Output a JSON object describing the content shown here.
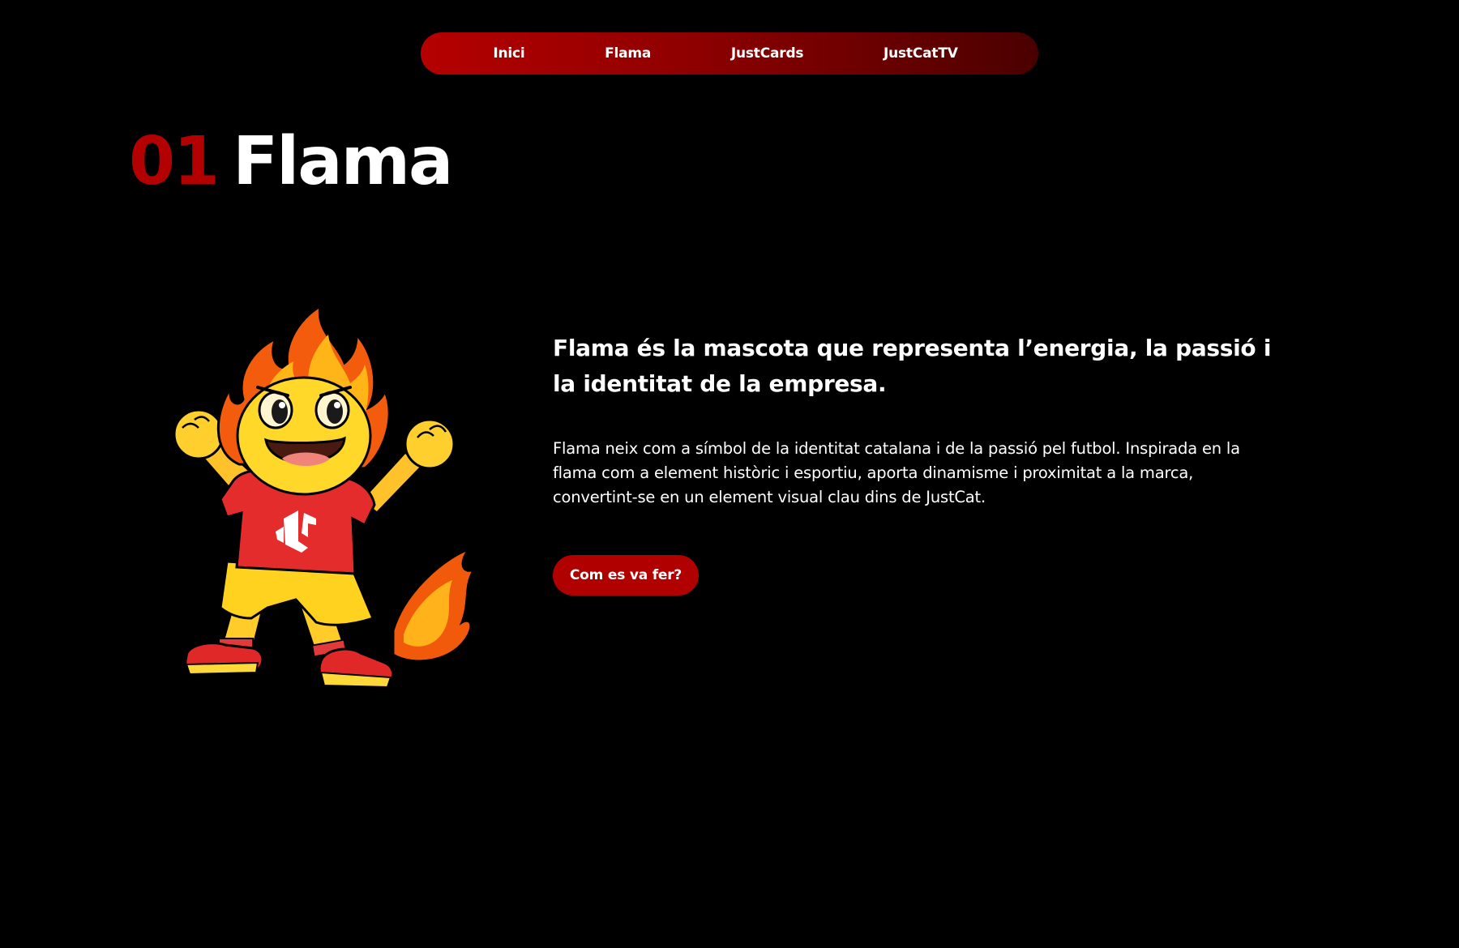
{
  "nav": {
    "items": [
      {
        "label": "Inici"
      },
      {
        "label": "Flama"
      },
      {
        "label": "JustCards"
      },
      {
        "label": "JustCatTV"
      }
    ]
  },
  "section": {
    "number": "01",
    "title": "Flama"
  },
  "content": {
    "lead": "Flama és la mascota que representa l’energia, la passió i la identitat de la empresa.",
    "body": "Flama neix com a símbol de la identitat catalana i de la passió pel futbol. Inspirada en la flama com a element històric i esportiu, aporta dinamisme i proximitat a la marca, convertint-se en un element visual clau dins de JustCat.",
    "cta_label": "Com es va fer?"
  },
  "mascot": {
    "icon": "flame-mascot-illustration",
    "shirt_logo": "justcat-logo-icon"
  },
  "colors": {
    "background": "#000000",
    "accent_red": "#b30000",
    "nav_gradient_start": "#b50000",
    "nav_gradient_end": "#4a0000",
    "text": "#ffffff"
  }
}
